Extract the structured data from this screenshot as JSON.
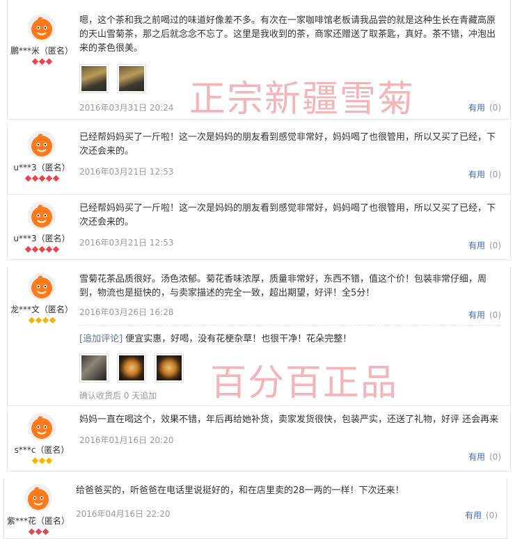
{
  "reviews": [
    {
      "user": "鵬***米（匿名）",
      "text": "嗯，这个茶和我之前喝过的味道好像差不多。有次在一家咖啡馆老板请我品尝的就是这种生长在青藏高原的天山雪菊茶，那之后就念念不忘了。这里是我收到的茶，商家还赠送了取茶匙，真好。茶不错，冲泡出来的茶色很美。",
      "date": "2016年03月31日 20:24",
      "useful_label": "有用",
      "useful_count": "(0)"
    },
    {
      "user": "u***3（匿名）",
      "text": "已经帮妈妈买了一斤啦！这一次是妈妈的朋友看到感觉非常好，妈妈喝了也很管用，所以又买了已经，下次还会来的。",
      "date": "2016年03月21日 12:53",
      "useful_label": "有用",
      "useful_count": "(0)"
    },
    {
      "user": "u***3（匿名）",
      "text": "已经帮妈妈买了一斤啦！这一次是妈妈的朋友看到感觉非常好，妈妈喝了也很管用，所以又买了已经，下次还会来的。",
      "date": "2016年03月21日 12:53",
      "useful_label": "有用",
      "useful_count": "(0)"
    },
    {
      "user": "龙***文（匿名）",
      "text": "雪菊花茶品质很好。汤色浓郁。菊花香味浓厚，质量非常好，东西不错，值这个价！包装非常仔细，周到，物流也是挺快的，与卖家描述的完全一致，超出期望，好评！全5分！",
      "date": "2016年03月26日 16:28",
      "useful_label": "有用",
      "useful_count": "(0)",
      "append_label": "[追加评论]",
      "append_text": "便宜实惠，好喝，没有花梗杂草！也很干净！花朵完整！",
      "append_note": "确认收货后 0 天追加"
    },
    {
      "user": "s***c（匿名）",
      "text": "妈妈一直在喝这个，效果不错，年后再给她补货，卖家发货很快，包装严实，还送了礼物，好评 还会再来",
      "date": "2016年01月16日 20:20",
      "useful_label": "有用",
      "useful_count": "(0)"
    },
    {
      "user": "紫***花（匿名）",
      "text": "给爸爸买的，听爸爸在电话里说挺好的，和在店里卖的28一两的一样！下次还来！",
      "date": "2016年04月16日 22:20",
      "useful_label": "有用",
      "useful_count": "(0)"
    }
  ],
  "watermarks": {
    "top": "正宗新疆雪菊",
    "middle": "百分百正品"
  },
  "colors": {
    "link_blue": "#3a6cb7",
    "watermark_pink": "#f1a9ab",
    "rank_red": "#e5474c",
    "rank_gold": "#f5b400"
  }
}
